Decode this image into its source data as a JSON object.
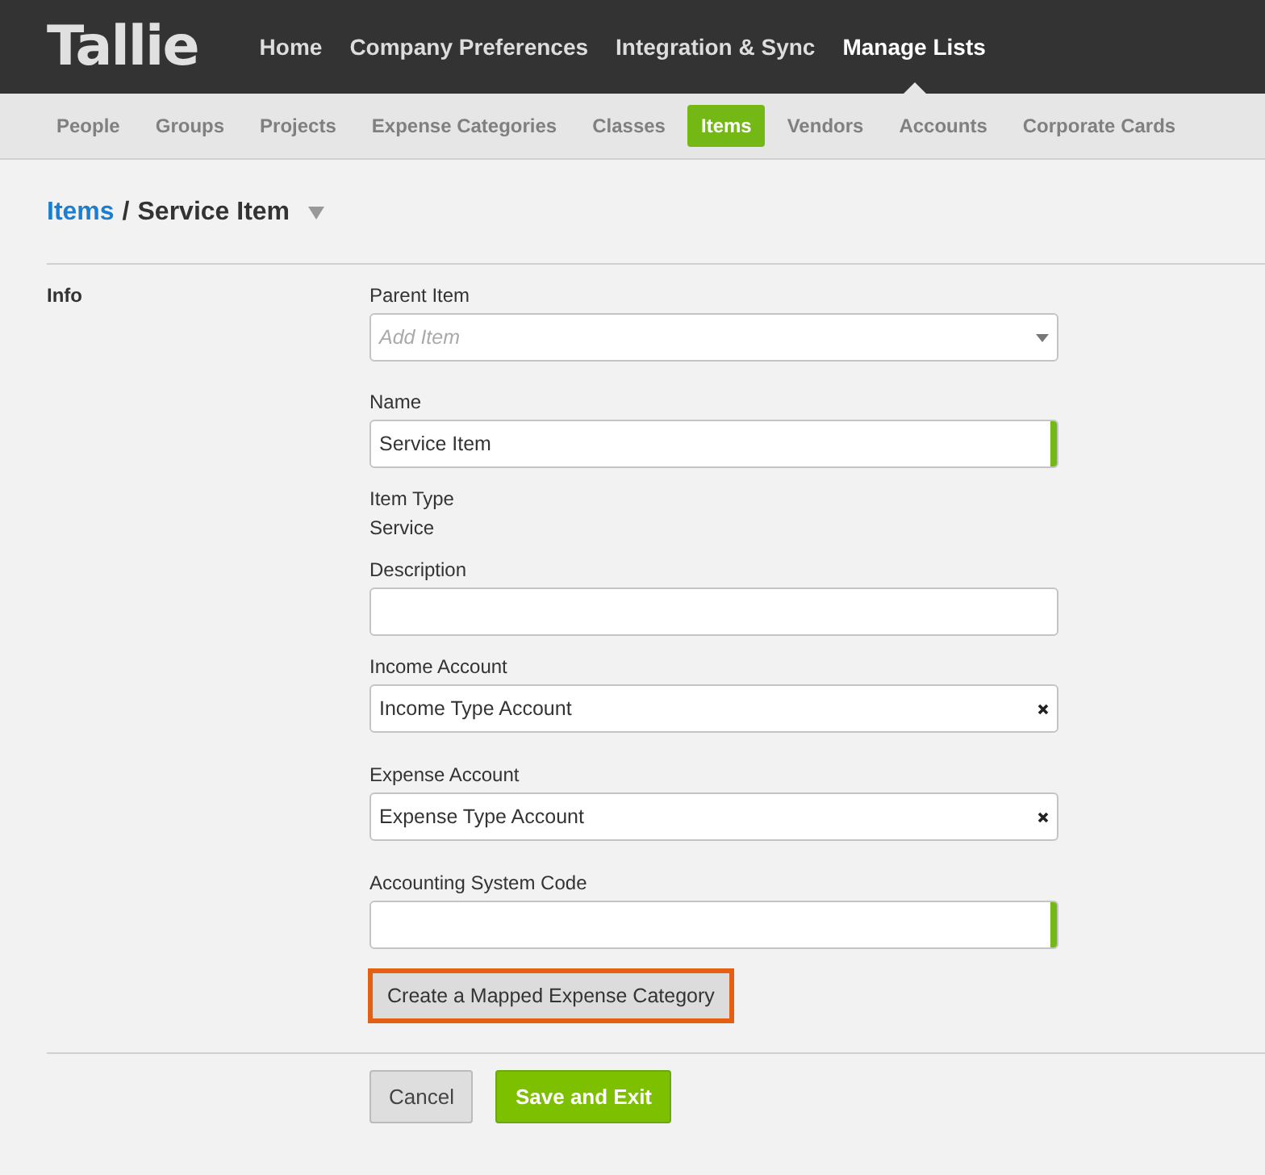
{
  "header": {
    "logo": "Tallie",
    "nav": [
      {
        "label": "Home",
        "selected": false
      },
      {
        "label": "Company Preferences",
        "selected": false
      },
      {
        "label": "Integration & Sync",
        "selected": false
      },
      {
        "label": "Manage Lists",
        "selected": true
      }
    ]
  },
  "subnav": [
    {
      "label": "People",
      "selected": false
    },
    {
      "label": "Groups",
      "selected": false
    },
    {
      "label": "Projects",
      "selected": false
    },
    {
      "label": "Expense Categories",
      "selected": false
    },
    {
      "label": "Classes",
      "selected": false
    },
    {
      "label": "Items",
      "selected": true
    },
    {
      "label": "Vendors",
      "selected": false
    },
    {
      "label": "Accounts",
      "selected": false
    },
    {
      "label": "Corporate Cards",
      "selected": false
    }
  ],
  "breadcrumb": {
    "link": "Items",
    "separator": "/",
    "current": "Service Item"
  },
  "section": {
    "label": "Info"
  },
  "fields": [
    {
      "kind": "dropdown",
      "label": "Parent Item",
      "placeholder": "Add Item"
    },
    {
      "kind": "text",
      "label": "Name",
      "value": "Service Item",
      "required": true
    },
    {
      "kind": "static",
      "label": "Item Type",
      "value": "Service"
    },
    {
      "kind": "text",
      "label": "Description",
      "required": false
    },
    {
      "kind": "clearable",
      "label": "Income Account",
      "value": "Income Type Account"
    },
    {
      "kind": "clearable",
      "label": "Expense Account",
      "value": "Expense Type Account"
    },
    {
      "kind": "text",
      "label": "Accounting System Code",
      "required": true
    }
  ],
  "mapped_button": {
    "label": "Create a Mapped Expense Category",
    "highlighted": true
  },
  "actions": [
    {
      "kind": "secondary",
      "label": "Cancel"
    },
    {
      "kind": "primary",
      "label": "Save and Exit"
    }
  ]
}
